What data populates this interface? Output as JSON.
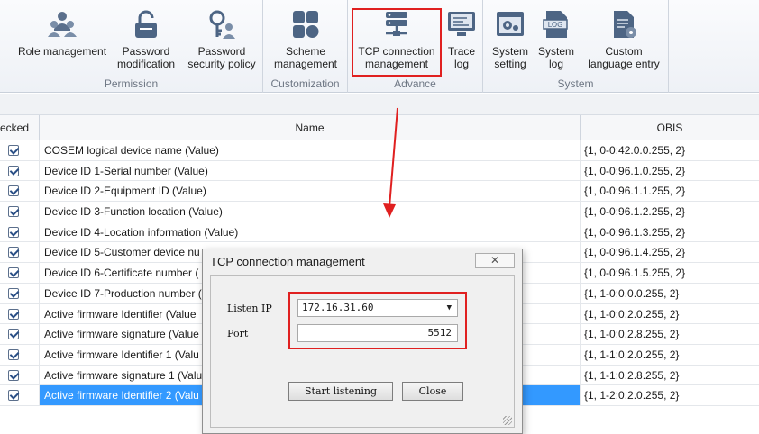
{
  "ribbon": {
    "groups": [
      {
        "label": "Permission"
      },
      {
        "label": "Customization"
      },
      {
        "label": "Advance"
      },
      {
        "label": "System"
      }
    ],
    "buttons": {
      "role_management": [
        "Role management"
      ],
      "password_modification": [
        "Password",
        "modification"
      ],
      "password_security_policy": [
        "Password",
        "security policy"
      ],
      "scheme_management": [
        "Scheme",
        "management"
      ],
      "tcp_connection_management": [
        "TCP connection",
        "management"
      ],
      "trace_log": [
        "Trace",
        "log"
      ],
      "system_setting": [
        "System",
        "setting"
      ],
      "system_log": [
        "System",
        "log"
      ],
      "custom_language_entry": [
        "Custom",
        "language entry"
      ]
    },
    "icons": {
      "role_management": "users-icon",
      "password_modification": "padlock-icon",
      "password_security_policy": "key-user-icon",
      "scheme_management": "scheme-grid-icon",
      "tcp_connection_management": "server-network-icon",
      "trace_log": "monitor-log-icon",
      "system_setting": "settings-window-icon",
      "system_log": "log-file-icon",
      "custom_language_entry": "document-gear-icon"
    },
    "highlight_color": "#e02020"
  },
  "grid": {
    "headers": {
      "checked": "ecked",
      "name": "Name",
      "obis": "OBIS"
    },
    "rows": [
      {
        "name": "COSEM logical device name (Value)",
        "obis": "{1, 0-0:42.0.0.255, 2}"
      },
      {
        "name": "Device ID 1-Serial number (Value)",
        "obis": "{1, 0-0:96.1.0.255, 2}"
      },
      {
        "name": "Device ID 2-Equipment ID (Value)",
        "obis": "{1, 0-0:96.1.1.255, 2}"
      },
      {
        "name": "Device ID 3-Function location (Value)",
        "obis": "{1, 0-0:96.1.2.255, 2}"
      },
      {
        "name": "Device ID 4-Location information (Value)",
        "obis": "{1, 0-0:96.1.3.255, 2}"
      },
      {
        "name": "Device ID 5-Customer device nu",
        "obis": "{1, 0-0:96.1.4.255, 2}"
      },
      {
        "name": "Device ID 6-Certificate number (",
        "obis": "{1, 0-0:96.1.5.255, 2}"
      },
      {
        "name": "Device ID 7-Production number (",
        "obis": "{1, 1-0:0.0.0.255, 2}"
      },
      {
        "name": "Active firmware Identifier (Value",
        "obis": "{1, 1-0:0.2.0.255, 2}"
      },
      {
        "name": "Active firmware signature (Value",
        "obis": "{1, 1-0:0.2.8.255, 2}"
      },
      {
        "name": "Active firmware Identifier 1 (Valu",
        "obis": "{1, 1-1:0.2.0.255, 2}"
      },
      {
        "name": "Active firmware signature 1 (Valu",
        "obis": "{1, 1-1:0.2.8.255, 2}"
      },
      {
        "name": "Active firmware Identifier 2 (Valu",
        "obis": "{1, 1-2:0.2.0.255, 2}",
        "selected": true
      }
    ],
    "selection_color": "#3399ff"
  },
  "dialog": {
    "title": "TCP connection management",
    "close_icon": "close-x-icon",
    "listen_ip_label": "Listen IP",
    "listen_ip_value": "172.16.31.60",
    "port_label": "Port",
    "port_value": "5512",
    "start_button": "Start listening",
    "close_button": "Close"
  }
}
